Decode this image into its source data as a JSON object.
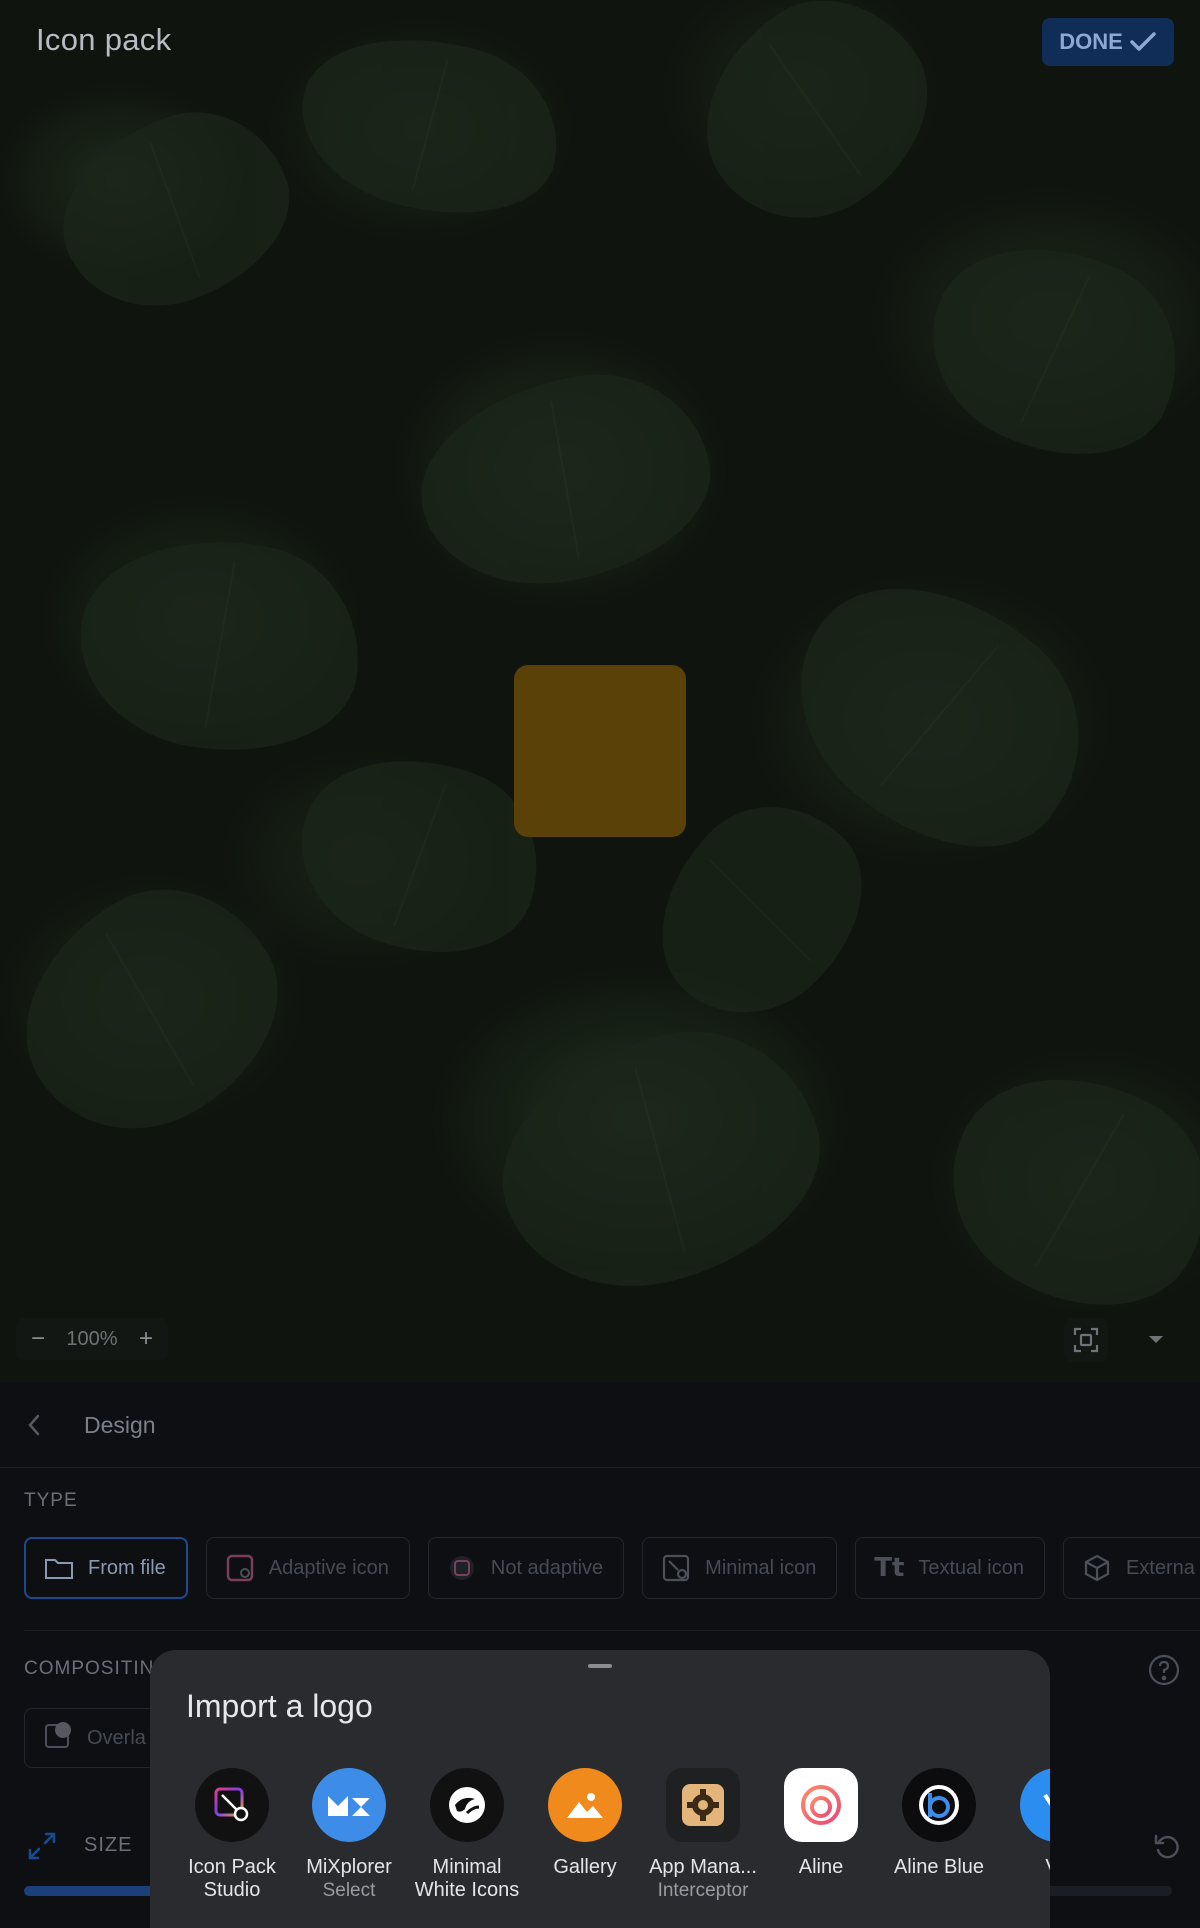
{
  "topbar": {
    "title": "Icon pack",
    "done_label": "DONE"
  },
  "preview": {
    "zoom": {
      "minus": "−",
      "level": "100%",
      "plus": "+"
    },
    "icon_color": "#5a4108"
  },
  "panel": {
    "header": {
      "title": "Design"
    },
    "type": {
      "label": "TYPE",
      "options": [
        {
          "label": "From file",
          "selected": true
        },
        {
          "label": "Adaptive icon"
        },
        {
          "label": "Not adaptive"
        },
        {
          "label": "Minimal icon"
        },
        {
          "label": "Textual icon"
        },
        {
          "label": "Externa"
        }
      ]
    },
    "compositing": {
      "label": "COMPOSITIN",
      "overlay_label": "Overla"
    },
    "size": {
      "label": "SIZE"
    }
  },
  "import_sheet": {
    "title": "Import a logo",
    "apps": [
      {
        "name_line1": "Icon Pack",
        "name_line2": "Studio",
        "sub": ""
      },
      {
        "name_line1": "MiXplorer",
        "name_line2": "",
        "sub": "Select"
      },
      {
        "name_line1": "Minimal",
        "name_line2": "White Icons",
        "sub": ""
      },
      {
        "name_line1": "Gallery",
        "name_line2": "",
        "sub": ""
      },
      {
        "name_line1": "App Mana...",
        "name_line2": "",
        "sub": "Interceptor"
      },
      {
        "name_line1": "Aline",
        "name_line2": "",
        "sub": ""
      },
      {
        "name_line1": "Aline Blue",
        "name_line2": "",
        "sub": ""
      },
      {
        "name_line1": "Ve",
        "name_line2": "",
        "sub": ""
      }
    ]
  },
  "colors": {
    "accent": "#1c4a8f",
    "done_bg": "#0f2d57",
    "sheet_bg": "#2a2b2f",
    "gallery_orange": "#f08a1c",
    "mixplorer_blue": "#3d8de8"
  },
  "icons": [
    "check-icon",
    "zoom-minus-icon",
    "zoom-plus-icon",
    "fit-screen-icon",
    "chevron-down-icon",
    "chevron-left-icon",
    "folder-icon",
    "adaptive-icon",
    "not-adaptive-icon",
    "minimal-icon",
    "textual-icon",
    "cube-icon",
    "help-icon",
    "overlay-icon",
    "expand-icon",
    "reset-icon"
  ]
}
